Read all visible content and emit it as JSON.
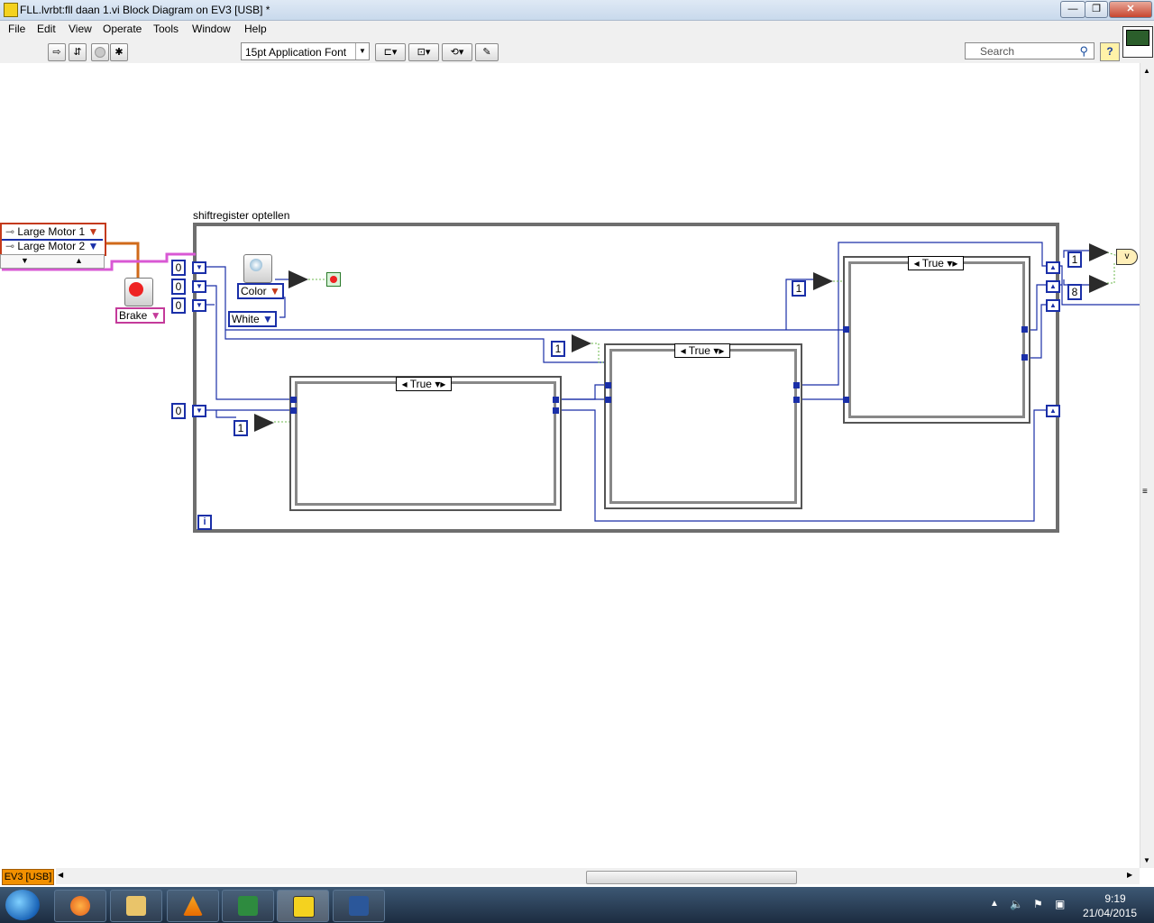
{
  "window": {
    "title": "FLL.lvrbt:fll daan 1.vi Block Diagram on EV3 [USB] *",
    "min": "—",
    "max": "❐",
    "close": "✕"
  },
  "menu": [
    "File",
    "Edit",
    "View",
    "Operate",
    "Tools",
    "Window",
    "Help"
  ],
  "toolbar": {
    "font": "15pt Application Font",
    "search_placeholder": "Search",
    "help": "?"
  },
  "diagram": {
    "loop_label": "shiftregister optellen",
    "iteration_terminal": "i",
    "motor_ports": [
      "Large Motor 1",
      "Large Motor 2"
    ],
    "brake_label": "Brake",
    "color_mode": "Color",
    "color_value": "White",
    "shift_init": [
      "0",
      "0",
      "0",
      "0"
    ],
    "case_selectors": [
      "True",
      "True",
      "True"
    ],
    "constants": [
      "1",
      "1",
      "1",
      "1",
      "8"
    ],
    "compare": "="
  },
  "status": {
    "target": "EV3 [USB]"
  },
  "taskbar": {
    "time": "9:19",
    "date": "21/04/2015"
  }
}
